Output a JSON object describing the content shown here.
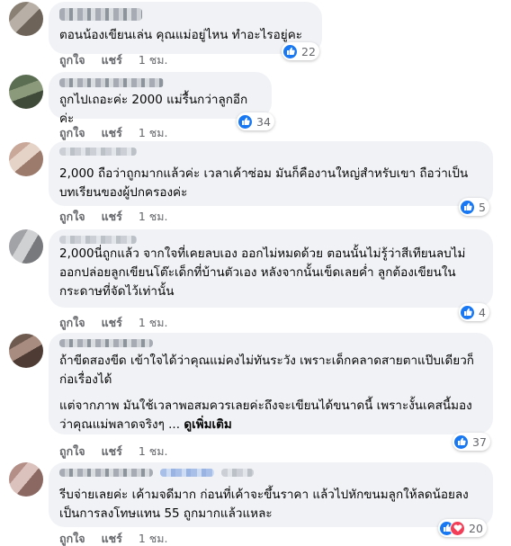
{
  "colors": {
    "bubble": "#f0f2f5",
    "like_blue": "#1877f2",
    "love_red": "#f33e58",
    "meta_gray": "#65676b"
  },
  "actions": {
    "like_label": "ถูกใจ",
    "share_label": "แชร์"
  },
  "comments": [
    {
      "text": "ตอนน้องเขียนเล่น คุณแม่อยู่ไหน ทำอะไรอยู่คะ",
      "time": "1 ชม.",
      "reaction_count": "22",
      "reactions": [
        "like-icon"
      ]
    },
    {
      "text": "ถูกไปเถอะค่ะ 2000 แม่รื้นกว่าลูกอีกค่ะ",
      "time": "1 ชม.",
      "reaction_count": "34",
      "reactions": [
        "like-icon"
      ]
    },
    {
      "text": "2,000 ถือว่าถูกมากแล้วค่ะ เวลาเค้าซ่อม มันก็คืองานใหญ่สำหรับเขา ถือว่าเป็นบทเรียนของผู้ปกครองค่ะ",
      "time": "1 ชม.",
      "reaction_count": "5",
      "reactions": [
        "like-icon"
      ]
    },
    {
      "text": "2,000นี่ถูกแล้ว จากใจที่เคยลบเอง ออกไม่หมดด้วย ตอนนั้นไม่รู้ว่าสีเทียนลบไม่ออกปล่อยลูกเขียนโต๊ะเด็กที่บ้านตัวเอง หลังจากนั้นเข็ดเลยค่ำ ลูกต้องเขียนในกระดาษที่จัดไว้เท่านั้น",
      "time": "1 ชม.",
      "reaction_count": "4",
      "reactions": [
        "like-icon"
      ]
    },
    {
      "text": "ถ้าขีดสองขีด เข้าใจได้ว่าคุณแม่คงไม่ทันระวัง เพราะเด็กคลาดสายตาแป๊บเดียวก็ก่อเรื่องได้",
      "text2": "แต่จากภาพ มันใช้เวลาพอสมควรเลยค่ะถึงจะเขียนได้ขนาดนี้ เพราะงั้นเคสนี้มองว่าคุณแม่พลาดจริงๆ ...",
      "see_more": "ดูเพิ่มเติม",
      "time": "1 ชม.",
      "reaction_count": "37",
      "reactions": [
        "like-icon"
      ]
    },
    {
      "text": "รีบจ่ายเลยค่ะ เค้ามจดีมาก ก่อนที่เค้าจะขึ้นราคา แล้วไปหักขนมลูกให้ลดน้อยลงเป็นการลงโทษแทน 55 ถูกมากแล้วแหละ",
      "time": "1 ชม.",
      "reaction_count": "20",
      "reactions": [
        "like-icon",
        "love-icon"
      ]
    }
  ]
}
